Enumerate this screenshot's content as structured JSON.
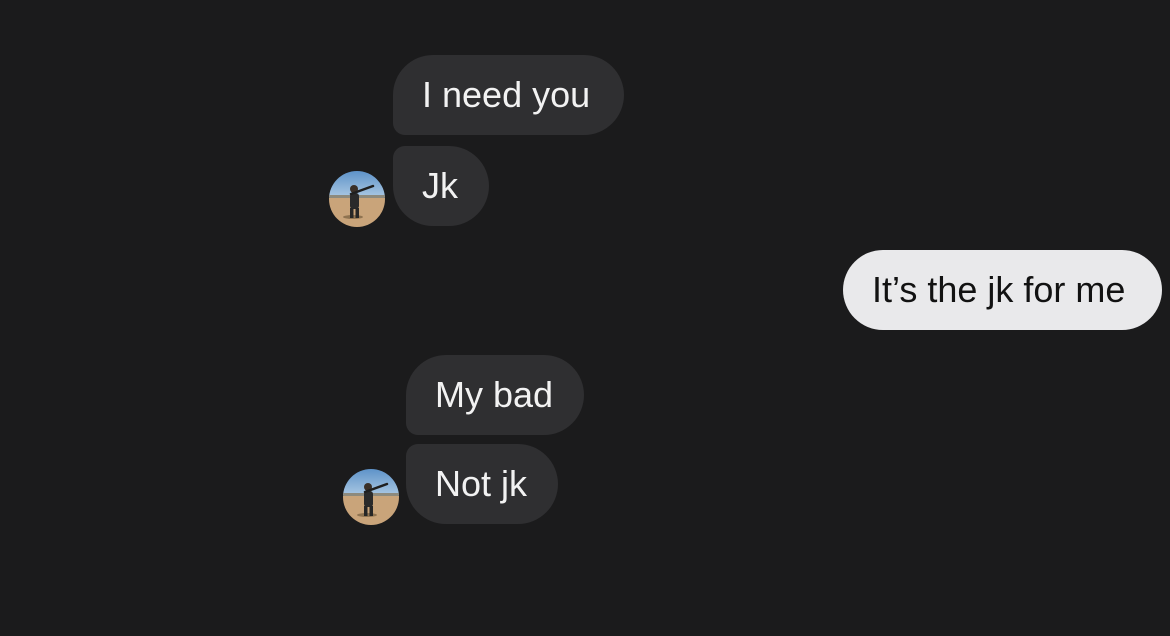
{
  "conversation": {
    "messages": [
      {
        "sender": "them",
        "text": "I need you"
      },
      {
        "sender": "them",
        "text": "Jk"
      },
      {
        "sender": "me",
        "text": "It’s the jk for me"
      },
      {
        "sender": "them",
        "text": "My bad"
      },
      {
        "sender": "them",
        "text": "Not jk"
      }
    ]
  },
  "colors": {
    "background": "#1b1b1c",
    "incoming_bubble": "#2f2f31",
    "outgoing_bubble": "#e9e9eb"
  }
}
